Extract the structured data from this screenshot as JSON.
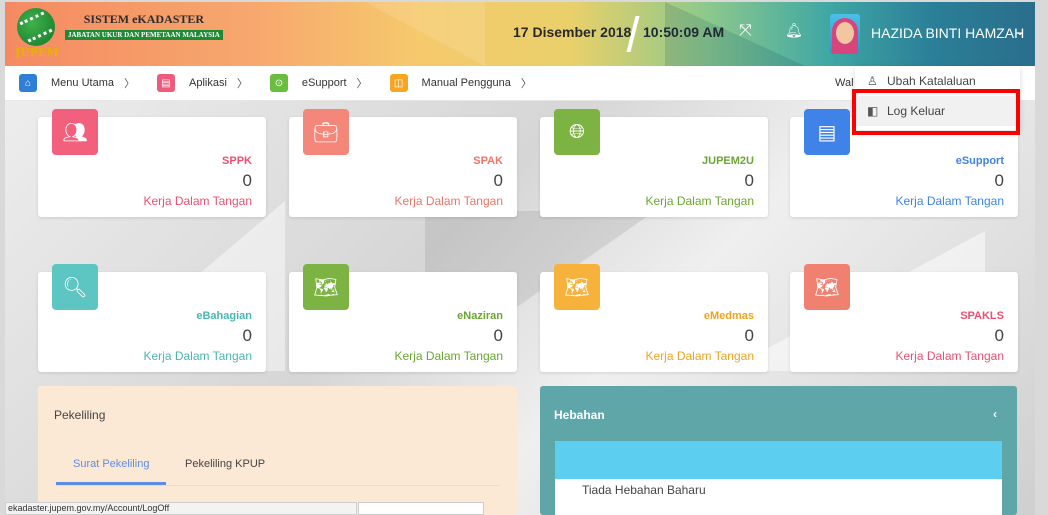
{
  "header": {
    "logo_title": "SISTEM eKADASTER",
    "logo_subtitle": "JABATAN UKUR DAN PEMETAAN MALAYSIA",
    "logo_brand": "JUPEM",
    "date": "17 Disember 2018",
    "time": "10:50:09 AM",
    "user_name": "HAZIDA BINTI HAMZAH",
    "colors": {
      "accent": "#2a6e8c",
      "warm": "#f58a62"
    }
  },
  "breadcrumb": {
    "items": [
      {
        "label": "Menu Utama",
        "icon": "home-icon",
        "color": "#2f7ed8"
      },
      {
        "label": "Aplikasi",
        "icon": "app-icon",
        "color": "#ef5b7c"
      },
      {
        "label": "eSupport",
        "icon": "support-icon",
        "color": "#6abe3f"
      },
      {
        "label": "Manual Pengguna",
        "icon": "book-icon",
        "color": "#f6a623"
      }
    ],
    "truncated_text": "Wal"
  },
  "user_menu": {
    "items": [
      {
        "label": "Ubah Katalaluan",
        "icon": "user-icon"
      },
      {
        "label": "Log Keluar",
        "icon": "logout-icon"
      }
    ]
  },
  "cards": [
    {
      "title": "SPPK",
      "count": "0",
      "subtitle": "Kerja Dalam Tangan",
      "color": "#f2607e",
      "icon": "users-icon"
    },
    {
      "title": "SPAK",
      "count": "0",
      "subtitle": "Kerja Dalam Tangan",
      "color": "#f4877a",
      "icon": "briefcase-icon"
    },
    {
      "title": "JUPEM2U",
      "count": "0",
      "subtitle": "Kerja Dalam Tangan",
      "color": "#7cb342",
      "icon": "globe-icon"
    },
    {
      "title": "eSupport",
      "count": "0",
      "subtitle": "Kerja Dalam Tangan",
      "color": "#3f83e8",
      "icon": "document-icon"
    },
    {
      "title": "eBahagian",
      "count": "0",
      "subtitle": "Kerja Dalam Tangan",
      "color": "#5ec6c2",
      "icon": "search-icon"
    },
    {
      "title": "eNaziran",
      "count": "0",
      "subtitle": "Kerja Dalam Tangan",
      "color": "#7cb342",
      "icon": "map-search-icon"
    },
    {
      "title": "eMedmas",
      "count": "0",
      "subtitle": "Kerja Dalam Tangan",
      "color": "#f7b23b",
      "icon": "map-search-icon"
    },
    {
      "title": "SPAKLS",
      "count": "0",
      "subtitle": "Kerja Dalam Tangan",
      "color": "#f08070",
      "icon": "map-search-icon"
    }
  ],
  "pekeliling": {
    "title": "Pekeliling",
    "tabs": [
      "Surat Pekeliling",
      "Pekeliling KPUP"
    ]
  },
  "hebahan": {
    "title": "Hebahan",
    "empty_text": "Tiada Hebahan Baharu"
  },
  "status_url": "ekadaster.jupem.gov.my/Account/LogOff"
}
